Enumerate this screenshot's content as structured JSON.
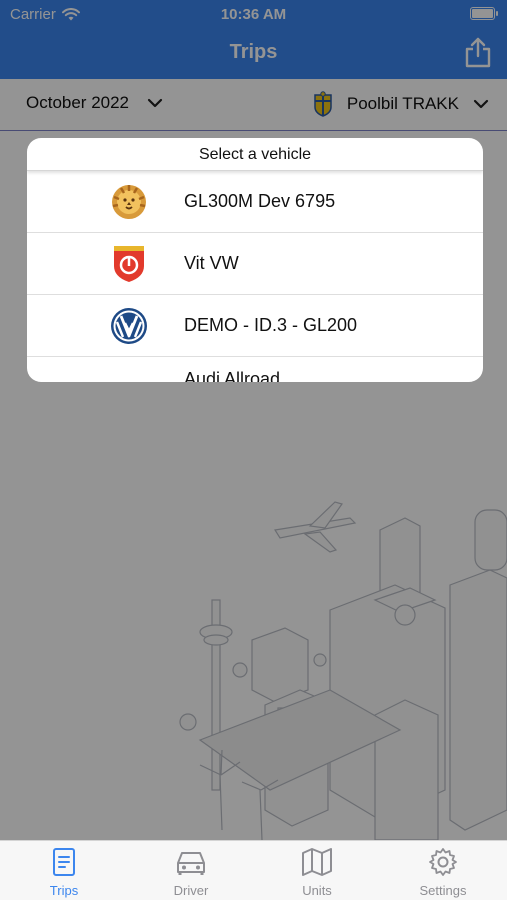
{
  "status": {
    "carrier": "Carrier",
    "time": "10:36 AM"
  },
  "nav": {
    "title": "Trips",
    "share_icon": "share-icon"
  },
  "filters": {
    "month": "October 2022",
    "vehicle": "Poolbil TRAKK"
  },
  "modal": {
    "title": "Select a vehicle",
    "items": [
      {
        "name": "GL300M Dev 6795",
        "logo": "lion-logo"
      },
      {
        "name": "Vit VW",
        "logo": "red-shield-logo"
      },
      {
        "name": "DEMO - ID.3 - GL200",
        "logo": "vw-logo"
      },
      {
        "name": "Audi Allroad",
        "logo": ""
      }
    ]
  },
  "tabs": [
    {
      "label": "Trips",
      "icon": "document-icon",
      "active": true
    },
    {
      "label": "Driver",
      "icon": "car-icon",
      "active": false
    },
    {
      "label": "Units",
      "icon": "map-icon",
      "active": false
    },
    {
      "label": "Settings",
      "icon": "gear-icon",
      "active": false
    }
  ],
  "colors": {
    "accent": "#3c86ee",
    "inactive": "#8e8e93"
  }
}
